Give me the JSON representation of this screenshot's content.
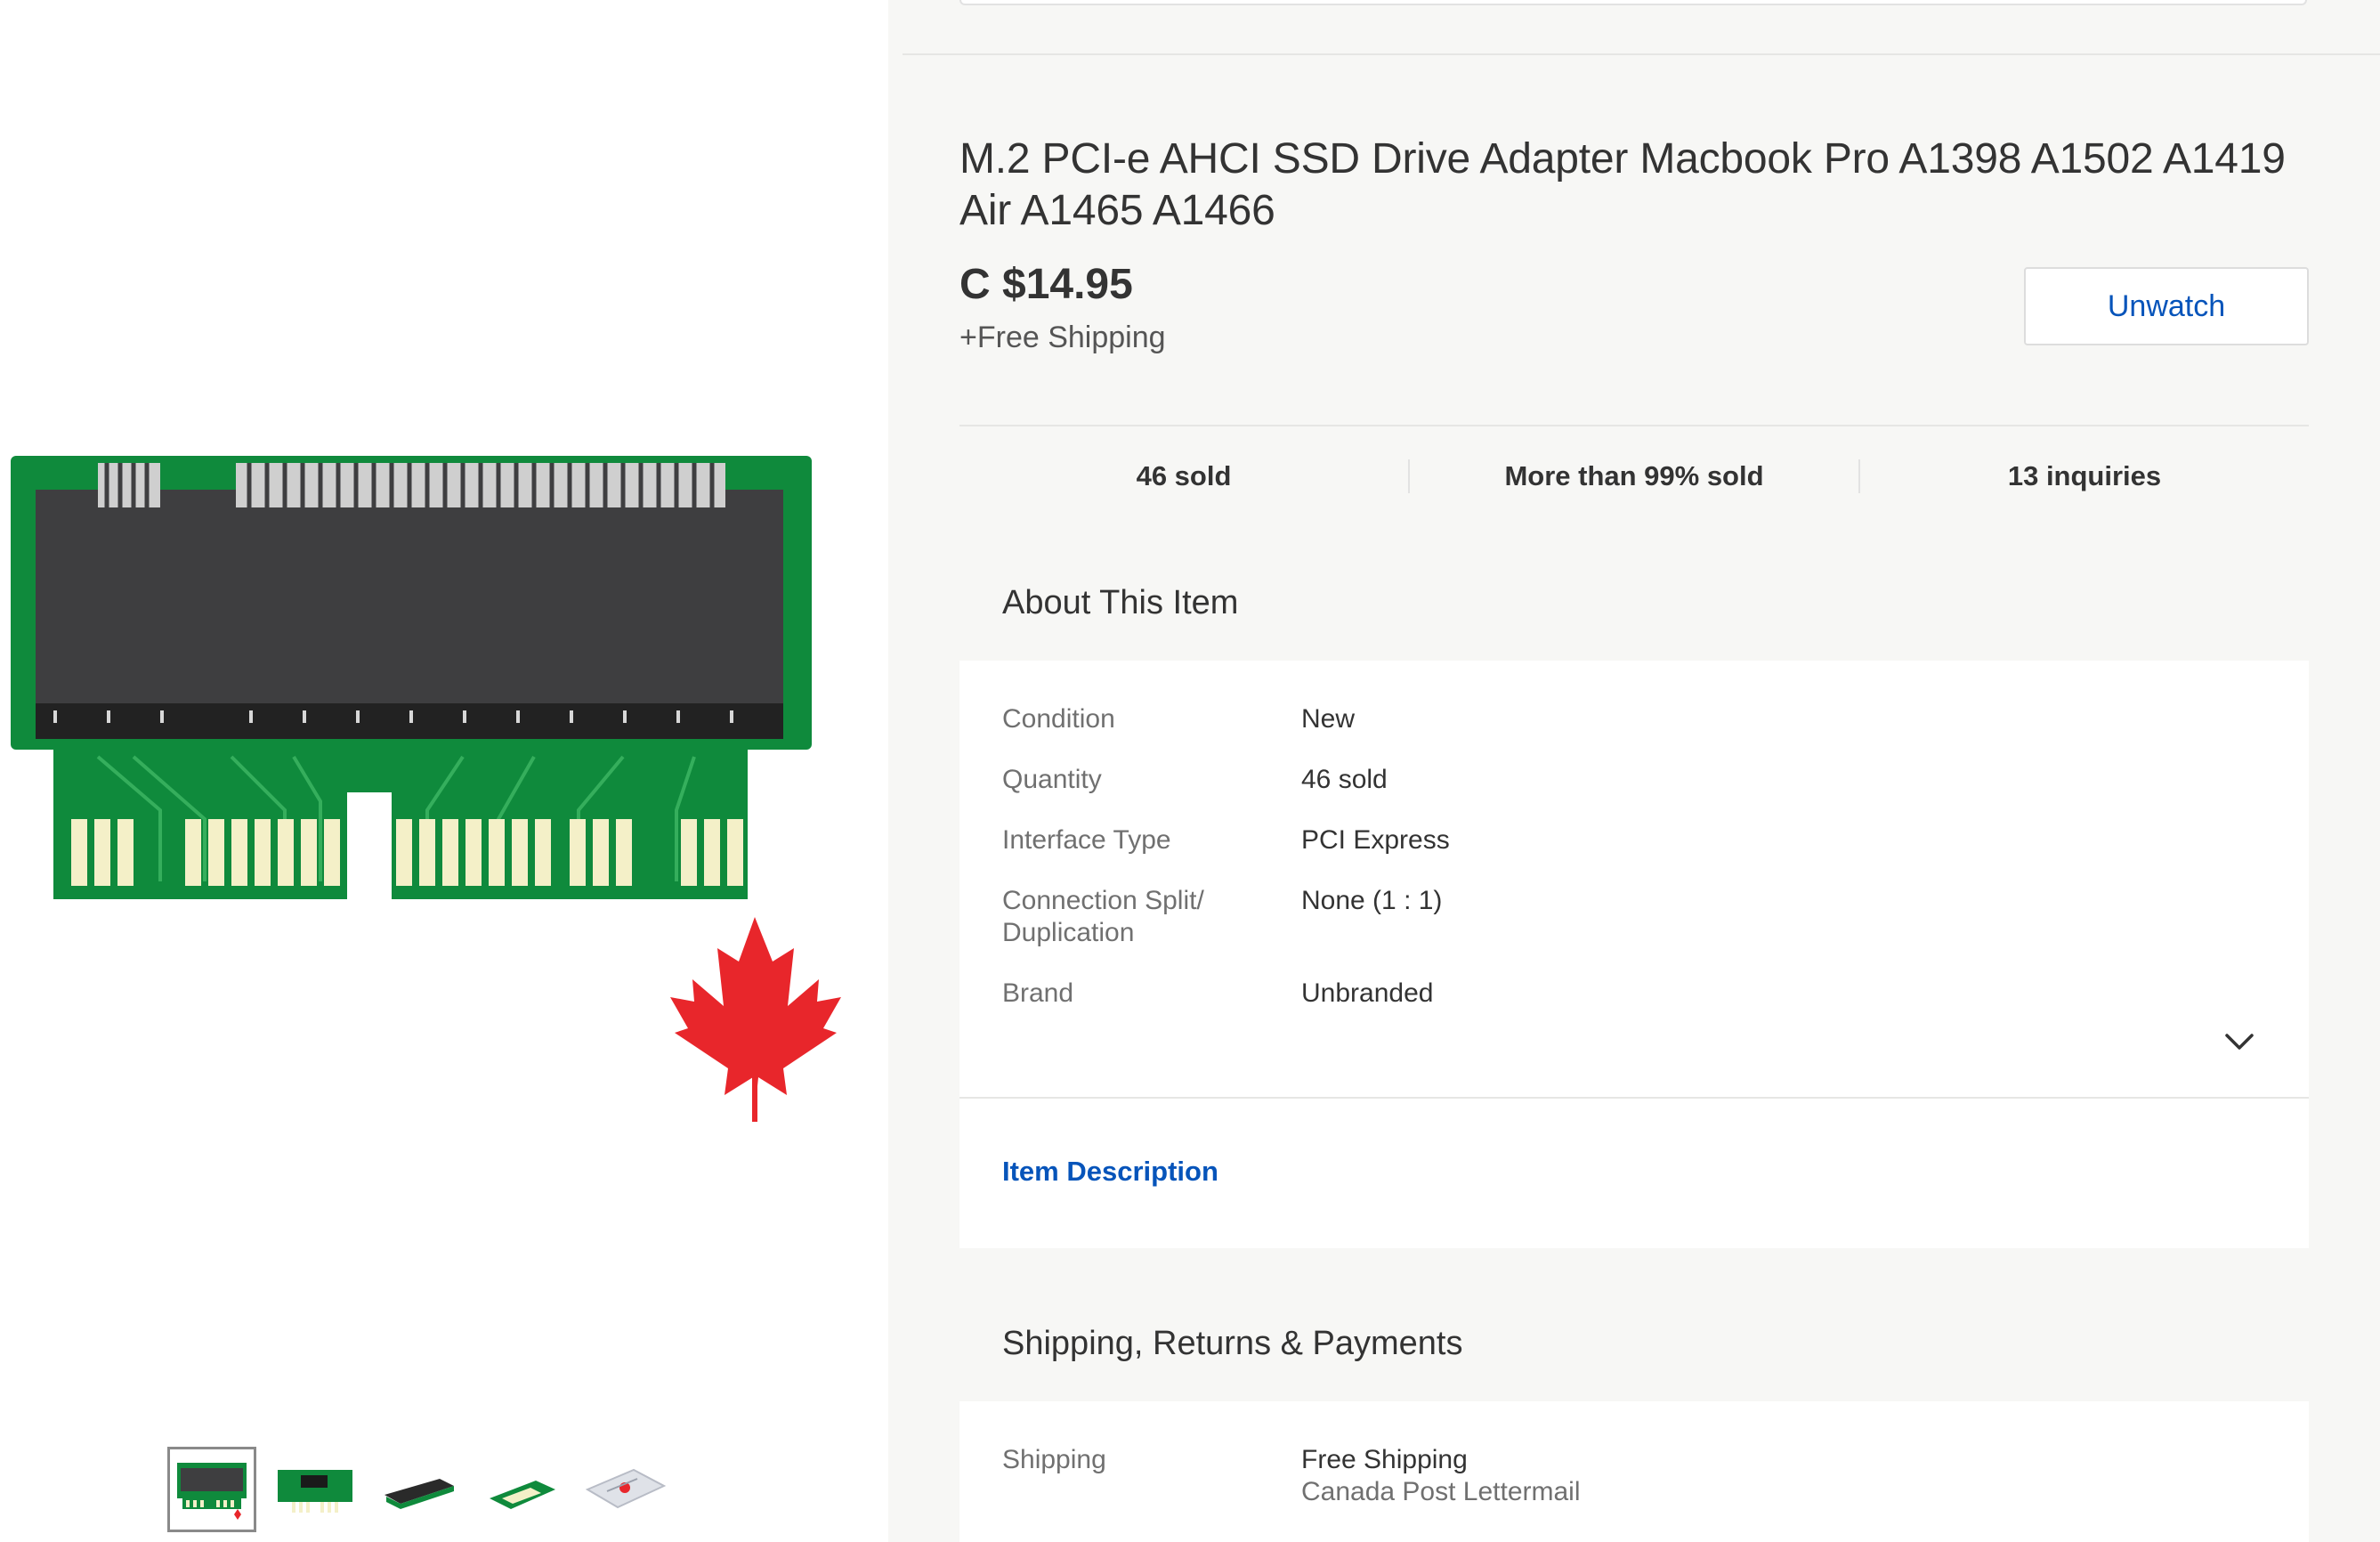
{
  "listing": {
    "title": "M.2 PCI-e AHCI SSD Drive Adapter Macbook Pro A1398 A1502 A1419 Air A1465 A1466",
    "price": "C $14.95",
    "shipping_note": "+Free Shipping",
    "watch_label": "Unwatch"
  },
  "stats": {
    "sold": "46 sold",
    "sell_through": "More than 99% sold",
    "inquiries": "13 inquiries"
  },
  "about": {
    "heading": "About This Item",
    "specs": [
      {
        "label": "Condition",
        "value": "New"
      },
      {
        "label": "Quantity",
        "value": "46 sold"
      },
      {
        "label": "Interface Type",
        "value": "PCI Express"
      },
      {
        "label": "Connection Split/ Duplication",
        "value": "None (1 : 1)"
      },
      {
        "label": "Brand",
        "value": "Unbranded"
      }
    ],
    "expand_icon": "chevron-down-icon",
    "description_link": "Item Description"
  },
  "shipping": {
    "heading": "Shipping, Returns & Payments",
    "label": "Shipping",
    "value": "Free Shipping",
    "carrier": "Canada Post Lettermail"
  },
  "gallery": {
    "thumbnail_count": 5,
    "selected_index": 0
  },
  "colors": {
    "link": "#0654ba",
    "pcb_green": "#0f8a3c",
    "maple_red": "#e8262b"
  }
}
